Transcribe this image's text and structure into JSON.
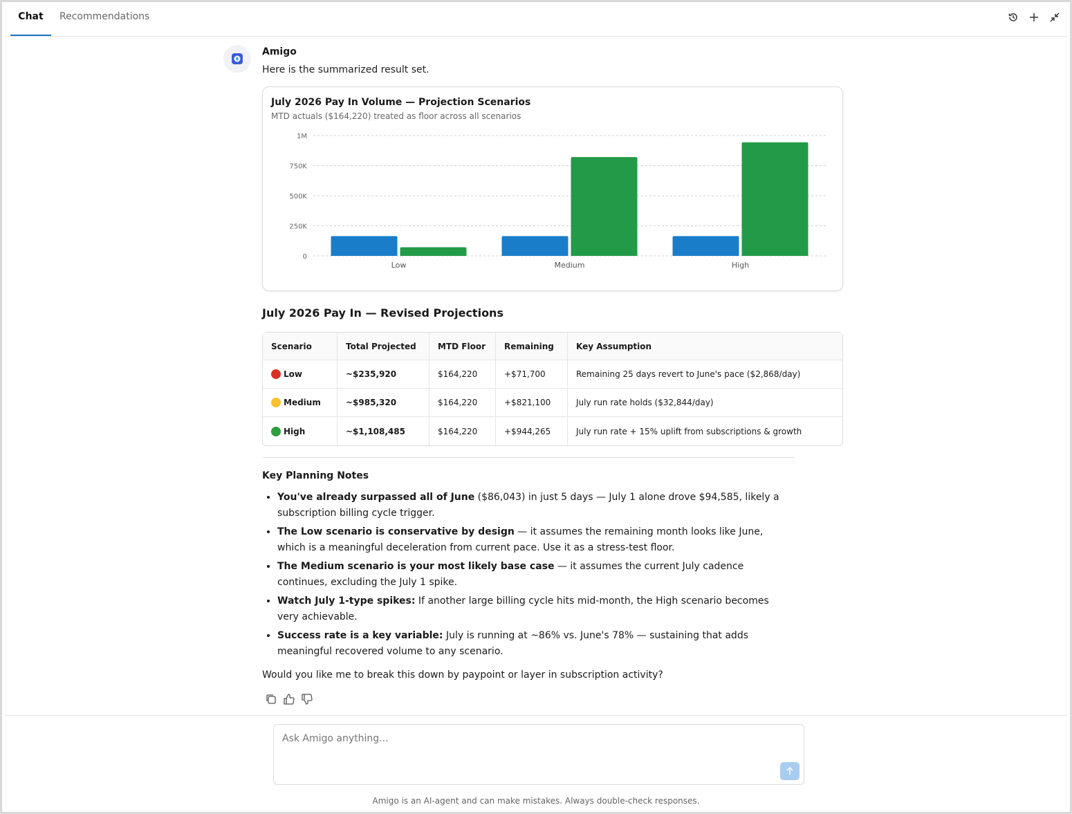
{
  "tabs": [
    {
      "label": "Chat"
    },
    {
      "label": "Recommendations"
    }
  ],
  "icons": {
    "history": "history-icon",
    "new": "plus-icon",
    "collapse": "collapse-icon"
  },
  "message": {
    "sender": "Amigo",
    "intro": "Here is the summarized result set.",
    "chart_title": "July 2026 Pay In Volume — Projection Scenarios",
    "chart_subtitle": "MTD actuals ($164,220) treated as floor across all scenarios",
    "table_title": "July 2026 Pay In — Revised Projections",
    "table": {
      "headers": [
        "Scenario",
        "Total Projected",
        "MTD Floor",
        "Remaining",
        "Key Assumption"
      ],
      "rows": [
        {
          "scenario": "Low",
          "color": "#d93025",
          "total": "~$235,920",
          "floor": "$164,220",
          "remaining": "+$71,700",
          "assumption": "Remaining 25 days revert to June's pace ($2,868/day)"
        },
        {
          "scenario": "Medium",
          "color": "#fbc02d",
          "total": "~$985,320",
          "floor": "$164,220",
          "remaining": "+$821,100",
          "assumption": "July run rate holds ($32,844/day)"
        },
        {
          "scenario": "High",
          "color": "#2e9e3e",
          "total": "~$1,108,485",
          "floor": "$164,220",
          "remaining": "+$944,265",
          "assumption": "July run rate + 15% uplift from subscriptions & growth"
        }
      ]
    },
    "notes_title": "Key Planning Notes",
    "notes": [
      {
        "bold": "You've already surpassed all of June",
        "text": " ($86,043) in just 5 days — July 1 alone drove $94,585, likely a subscription billing cycle trigger."
      },
      {
        "bold": "The Low scenario is conservative by design",
        "text": " — it assumes the remaining month looks like June, which is a meaningful deceleration from current pace. Use it as a stress-test floor."
      },
      {
        "bold": "The Medium scenario is your most likely base case",
        "text": " — it assumes the current July cadence continues, excluding the July 1 spike."
      },
      {
        "bold": "Watch July 1-type spikes:",
        "text": " If another large billing cycle hits mid-month, the High scenario becomes very achievable."
      },
      {
        "bold": "Success rate is a key variable:",
        "text": " July is running at ~86% vs. June's 78% — sustaining that adds meaningful recovered volume to any scenario."
      }
    ],
    "closing": "Would you like me to break this down by paypoint or layer in subscription activity?"
  },
  "composer": {
    "placeholder": "Ask Amigo anything..."
  },
  "disclaimer": "Amigo is an AI-agent and can make mistakes. Always double-check responses.",
  "chart_data": {
    "type": "bar",
    "categories": [
      "Low",
      "Medium",
      "High"
    ],
    "series": [
      {
        "values": [
          164220,
          164220,
          164220
        ],
        "color": "#1a7dc9"
      },
      {
        "values": [
          71700,
          821100,
          944265
        ],
        "color": "#239a48"
      }
    ],
    "yticks": [
      0,
      250000,
      500000,
      750000,
      1000000
    ],
    "ytick_labels": [
      "0",
      "250K",
      "500K",
      "750K",
      "1M"
    ],
    "ylim": [
      0,
      1000000
    ],
    "grid": true,
    "legend": "none"
  }
}
